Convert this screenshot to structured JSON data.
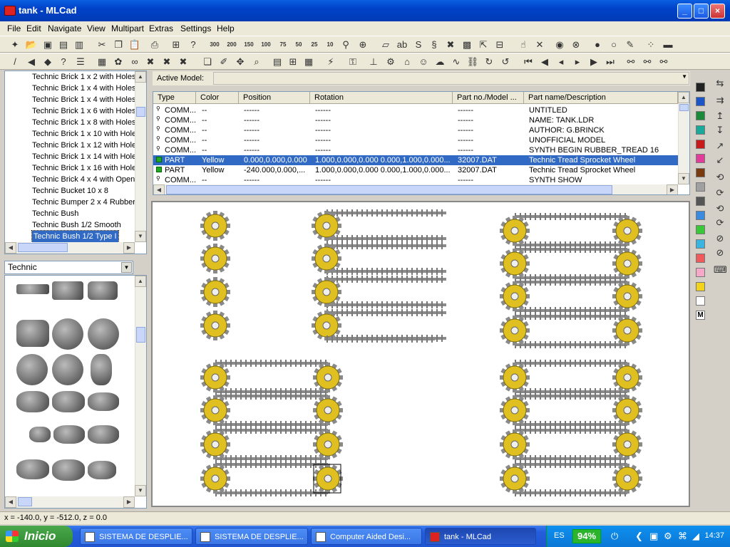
{
  "window": {
    "title": "tank - MLCad",
    "minimize": "_",
    "maximize": "□",
    "close": "×"
  },
  "menu": [
    "File",
    "Edit",
    "Navigate",
    "View",
    "Multipart",
    "Extras",
    "Settings",
    "Help"
  ],
  "tree": {
    "items": [
      "Technic Brick 1 x 2 with Holes",
      "Technic Brick 1 x 4 with Holes",
      "Technic Brick 1 x 4 with Holes",
      "Technic Brick 1 x 6 with Holes",
      "Technic Brick 1 x 8 with Holes",
      "Technic Brick 1 x 10 with Holes",
      "Technic Brick 1 x 12 with Holes",
      "Technic Brick 1 x 14 with Holes",
      "Technic Brick 1 x 16 with Holes",
      "Technic Brick 4 x 4 with Open",
      "Technic Bucket 10 x 8",
      "Technic Bumper 2 x 4 Rubber",
      "Technic Bush",
      "Technic Bush 1/2 Smooth",
      "Technic Bush 1/2 Type I"
    ],
    "selected_index": 14
  },
  "category": {
    "selected": "Technic"
  },
  "active_model": {
    "label": "Active Model:",
    "value": ""
  },
  "table": {
    "headers": [
      "Type",
      "Color",
      "Position",
      "Rotation",
      "Part no./Model ...",
      "Part name/Description"
    ],
    "rows": [
      {
        "type": "COMM...",
        "color": "--",
        "position": "------",
        "rotation": "------",
        "part": "------",
        "desc": "UNTITLED"
      },
      {
        "type": "COMM...",
        "color": "--",
        "position": "------",
        "rotation": "------",
        "part": "------",
        "desc": "NAME: TANK.LDR"
      },
      {
        "type": "COMM...",
        "color": "--",
        "position": "------",
        "rotation": "------",
        "part": "------",
        "desc": "AUTHOR: G.BRINCK"
      },
      {
        "type": "COMM...",
        "color": "--",
        "position": "------",
        "rotation": "------",
        "part": "------",
        "desc": "UNOFFICIAL MODEL"
      },
      {
        "type": "COMM...",
        "color": "--",
        "position": "------",
        "rotation": "------",
        "part": "------",
        "desc": "SYNTH BEGIN RUBBER_TREAD 16"
      },
      {
        "type": "PART",
        "color": "Yellow",
        "position": "0.000,0.000,0.000",
        "rotation": "1.000,0.000,0.000 0.000,1.000,0.000...",
        "part": "32007.DAT",
        "desc": "Technic Tread Sprocket Wheel"
      },
      {
        "type": "PART",
        "color": "Yellow",
        "position": "-240.000,0.000,...",
        "rotation": "1.000,0.000,0.000 0.000,1.000,0.000...",
        "part": "32007.DAT",
        "desc": "Technic Tread Sprocket Wheel"
      },
      {
        "type": "COMM...",
        "color": "--",
        "position": "------",
        "rotation": "------",
        "part": "------",
        "desc": "SYNTH SHOW"
      }
    ],
    "selected_index": 5
  },
  "palette": [
    "#222222",
    "#1c55c8",
    "#1a8a3a",
    "#1aa89a",
    "#c81a1a",
    "#e23c9a",
    "#7a3a10",
    "#a0a0a0",
    "#555555",
    "#3a8ae0",
    "#3ac83a",
    "#3ab4e0",
    "#f05a5a",
    "#f6a8c8",
    "#f2d21a",
    "#ffffff"
  ],
  "palette_more": "M",
  "status": {
    "coords": "x = -140.0, y = -512.0, z = 0.0"
  },
  "taskbar": {
    "start": "Inicio",
    "tasks": [
      "SISTEMA DE DESPLIE...",
      "SISTEMA DE DESPLIE...",
      "Computer Aided Desi...",
      "tank - MLCad"
    ],
    "active_index": 3,
    "lang": "ES",
    "battery": "94%",
    "clock": "14:37"
  },
  "colors": {
    "accent": "#316ac5",
    "sprocket": "#e0c020",
    "tread": "#8a8a8a"
  }
}
